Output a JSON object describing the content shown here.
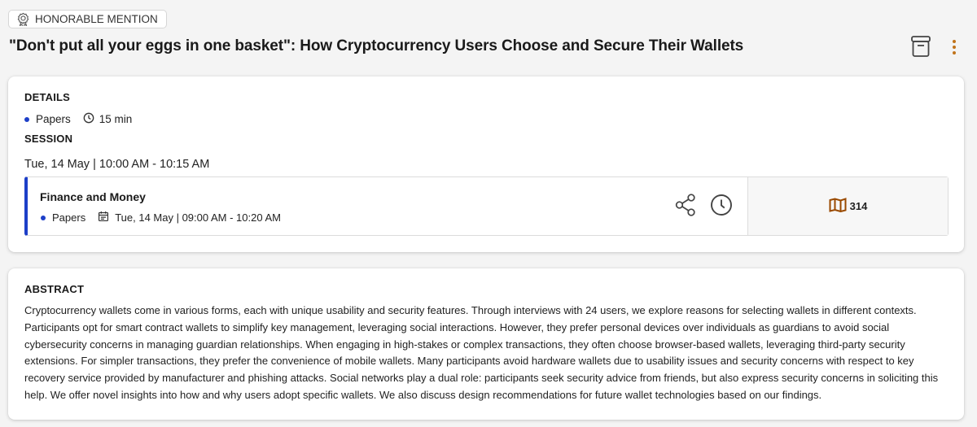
{
  "badge": {
    "label": "HONORABLE MENTION",
    "icon": "award-ribbon-icon"
  },
  "paper": {
    "title": "\"Don't put all your eggs in one basket\": How Cryptocurrency Users Choose and Secure Their Wallets"
  },
  "header_actions": {
    "archive_icon": "archive-box-icon",
    "more_icon": "kebab-menu-icon"
  },
  "details": {
    "heading": "DETAILS",
    "type": "Papers",
    "duration": "15 min",
    "session_heading": "SESSION",
    "session_time": "Tue, 14 May | 10:00 AM - 10:15 AM"
  },
  "session": {
    "name": "Finance and Money",
    "type": "Papers",
    "time": "Tue, 14 May | 09:00 AM - 10:20 AM",
    "room": "314",
    "share_icon": "share-icon",
    "clock_icon": "clock-icon",
    "room_icon": "map-icon"
  },
  "abstract": {
    "heading": "ABSTRACT",
    "text": "Cryptocurrency wallets come in various forms, each with unique usability and security features. Through interviews with 24 users, we explore reasons for selecting wallets in different contexts. Participants opt for smart contract wallets to simplify key management, leveraging social interactions. However, they prefer personal devices over individuals as guardians to avoid social cybersecurity concerns in managing guardian relationships. When engaging in high-stakes or complex transactions, they often choose browser-based wallets, leveraging third-party security extensions. For simpler transactions, they prefer the convenience of mobile wallets. Many participants avoid hardware wallets due to usability issues and security concerns with respect to key recovery service provided by manufacturer and phishing attacks. Social networks play a dual role: participants seek security advice from friends, but also express security concerns in soliciting this help. We offer novel insights into how and why users adopt specific wallets. We also discuss design recommendations for future wallet technologies based on our findings."
  },
  "colors": {
    "accent_blue": "#1d3fc8",
    "accent_orange": "#c0731a",
    "room_icon": "#9a4a00"
  }
}
